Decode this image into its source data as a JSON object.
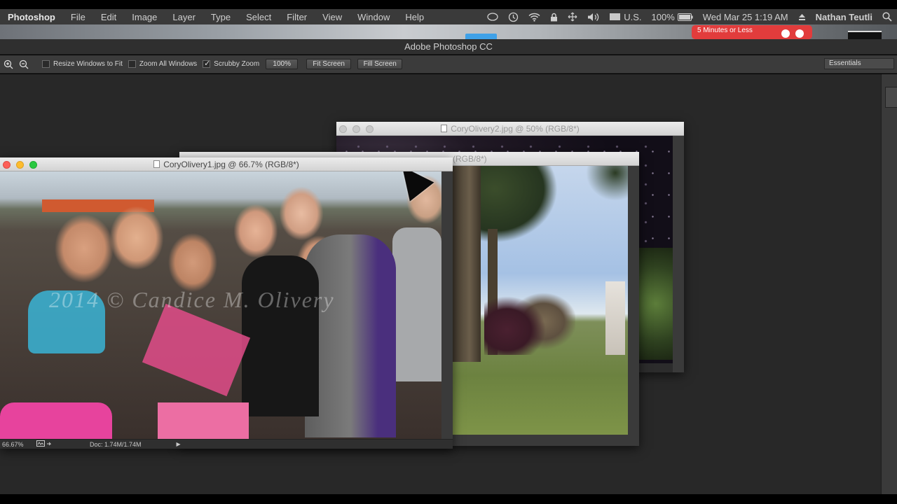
{
  "menubar": {
    "app": "Photoshop",
    "items": [
      "File",
      "Edit",
      "Image",
      "Layer",
      "Type",
      "Select",
      "Filter",
      "View",
      "Window",
      "Help"
    ],
    "region": "U.S.",
    "battery": "100%",
    "datetime": "Wed Mar 25  1:19 AM",
    "user": "Nathan Teutli"
  },
  "notification": {
    "text": "5 Minutes or Less"
  },
  "app_title": "Adobe Photoshop CC",
  "options": {
    "resize_windows": "Resize Windows to Fit",
    "zoom_all": "Zoom All Windows",
    "scrubby": "Scrubby Zoom",
    "btn_100": "100%",
    "btn_fit": "Fit Screen",
    "btn_fill": "Fill Screen",
    "workspace": "Essentials"
  },
  "documents": {
    "doc1": {
      "title": "CoryOlivery1.jpg @ 66.7% (RGB/8*)",
      "watermark": "2014 © Candice M. Olivery",
      "zoom": "66.67%",
      "docsize": "Doc: 1.74M/1.74M"
    },
    "doc2": {
      "title": "CoryOlivery2.jpg @ 50% (RGB/8*)"
    },
    "doc3": {
      "title": "(RGB/8*)"
    }
  }
}
